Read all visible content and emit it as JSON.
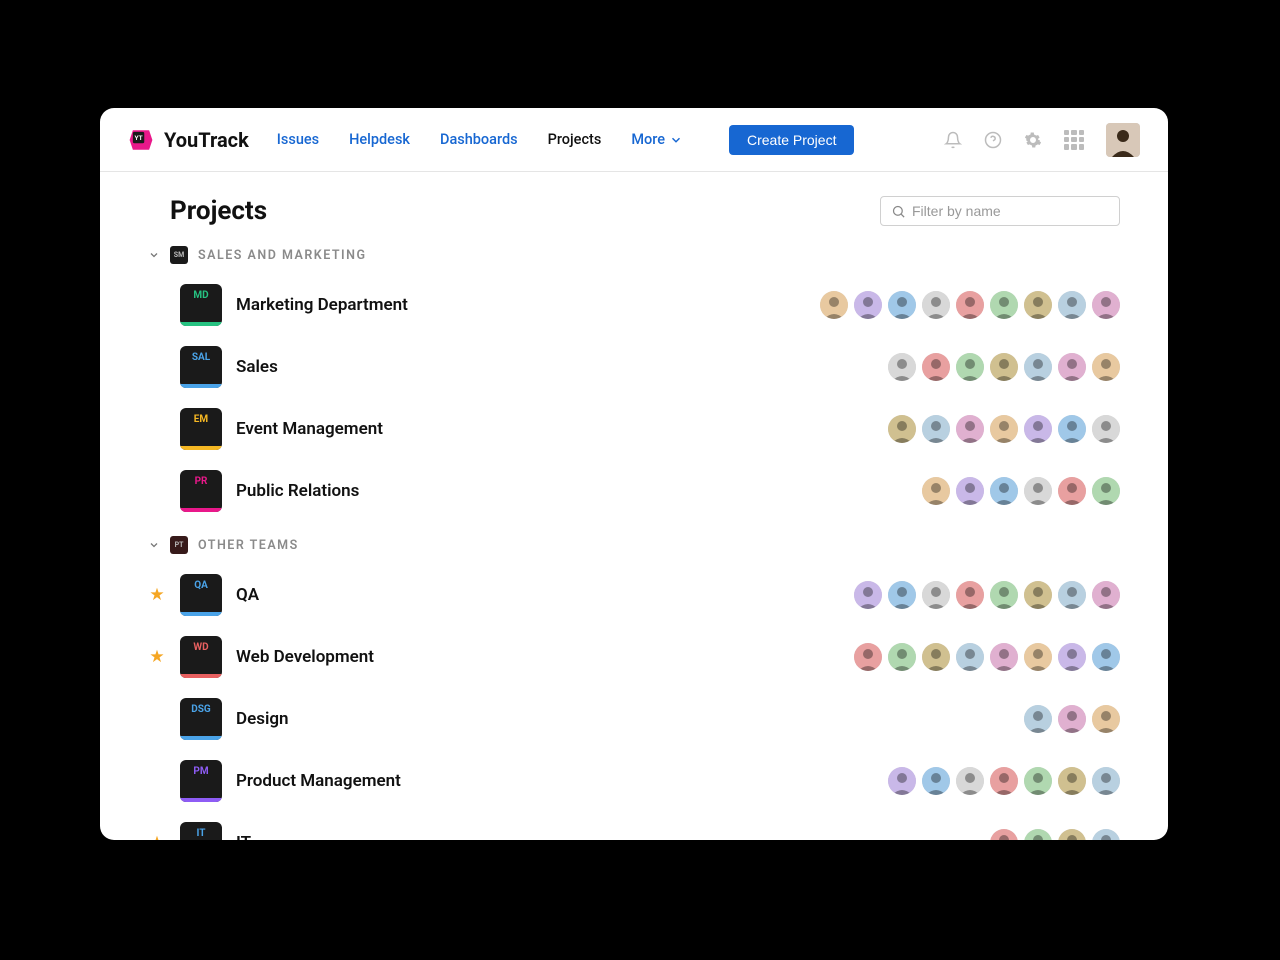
{
  "app": {
    "name": "YouTrack"
  },
  "nav": {
    "items": [
      {
        "label": "Issues",
        "active": false
      },
      {
        "label": "Helpdesk",
        "active": false
      },
      {
        "label": "Dashboards",
        "active": false
      },
      {
        "label": "Projects",
        "active": true
      },
      {
        "label": "More",
        "active": false,
        "dropdown": true
      }
    ],
    "create_label": "Create Project"
  },
  "page": {
    "title": "Projects"
  },
  "search": {
    "placeholder": "Filter by name"
  },
  "groups": [
    {
      "icon_abbr": "SM",
      "label": "SALES AND MARKETING",
      "projects": [
        {
          "abbr": "MD",
          "name": "Marketing Department",
          "abbr_color": "#26c281",
          "bar_color": "#26c281",
          "starred": false,
          "member_count": 9
        },
        {
          "abbr": "SAL",
          "name": "Sales",
          "abbr_color": "#4aa3e8",
          "bar_color": "#4aa3e8",
          "starred": false,
          "member_count": 7
        },
        {
          "abbr": "EM",
          "name": "Event Management",
          "abbr_color": "#f5b723",
          "bar_color": "#f5b723",
          "starred": false,
          "member_count": 7
        },
        {
          "abbr": "PR",
          "name": "Public Relations",
          "abbr_color": "#e9188a",
          "bar_color": "#e9188a",
          "starred": false,
          "member_count": 6
        }
      ]
    },
    {
      "icon_abbr": "PT",
      "label": "OTHER TEAMS",
      "projects": [
        {
          "abbr": "QA",
          "name": "QA",
          "abbr_color": "#4aa3e8",
          "bar_color": "#4aa3e8",
          "starred": true,
          "member_count": 8
        },
        {
          "abbr": "WD",
          "name": "Web Development",
          "abbr_color": "#e86060",
          "bar_color": "#e86060",
          "starred": true,
          "member_count": 8
        },
        {
          "abbr": "DSG",
          "name": "Design",
          "abbr_color": "#4aa3e8",
          "bar_color": "#4aa3e8",
          "starred": false,
          "member_count": 3
        },
        {
          "abbr": "PM",
          "name": "Product Management",
          "abbr_color": "#8e5cf5",
          "bar_color": "#8e5cf5",
          "starred": false,
          "member_count": 7
        },
        {
          "abbr": "IT",
          "name": "IT",
          "abbr_color": "#4aa3e8",
          "bar_color": "#4aa3e8",
          "starred": true,
          "member_count": 4
        }
      ]
    }
  ],
  "avatar_palette": [
    "#e8c9a0",
    "#c9b8e8",
    "#a0c8e8",
    "#d8d8d8",
    "#e8a0a0",
    "#b0d8b0",
    "#d0c090",
    "#b8d0e0",
    "#e0b0d0"
  ]
}
